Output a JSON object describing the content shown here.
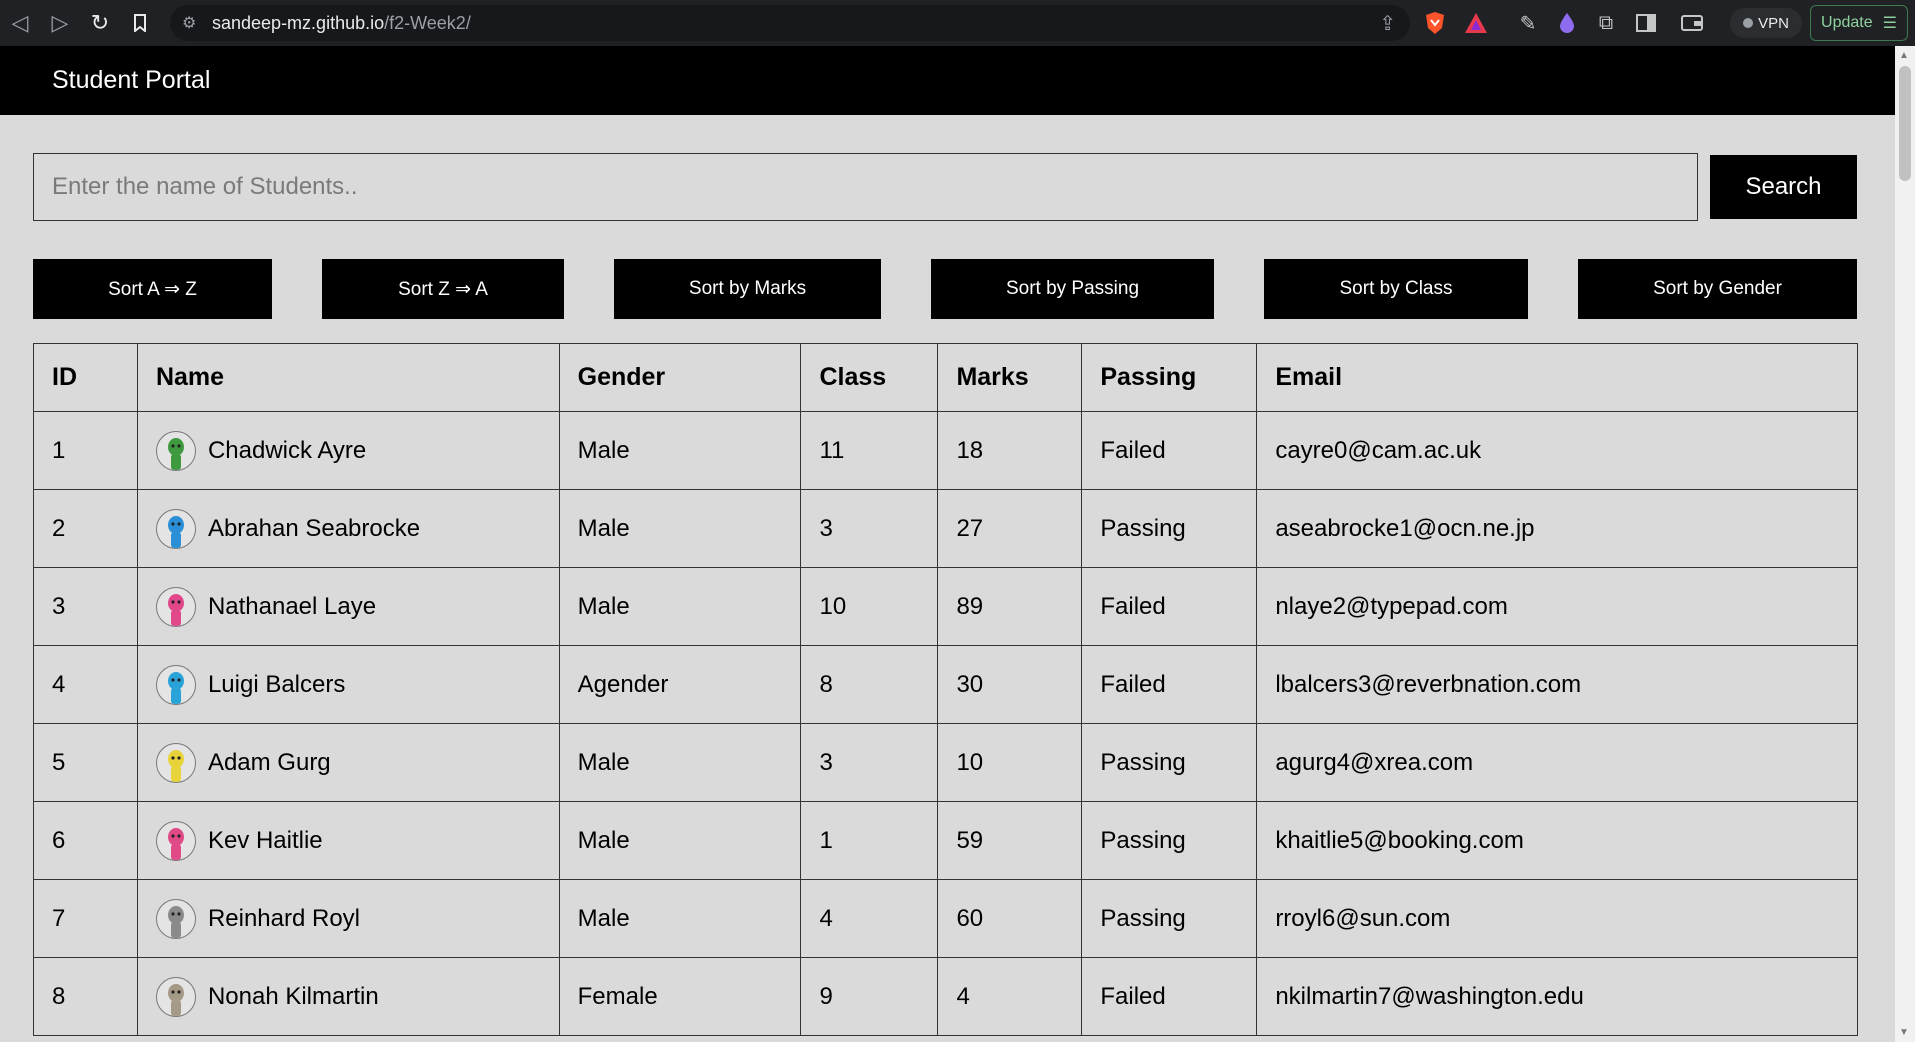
{
  "browser": {
    "url_host": "sandeep-mz.github.io",
    "url_path": "/f2-Week2/",
    "vpn_label": "VPN",
    "update_label": "Update"
  },
  "header": {
    "title": "Student Portal"
  },
  "search": {
    "placeholder": "Enter the name of Students..",
    "value": "",
    "button_label": "Search"
  },
  "sort_buttons": [
    {
      "label": "Sort A ⇒ Z"
    },
    {
      "label": "Sort Z ⇒ A"
    },
    {
      "label": "Sort by Marks"
    },
    {
      "label": "Sort by Passing"
    },
    {
      "label": "Sort by Class"
    },
    {
      "label": "Sort by Gender"
    }
  ],
  "table": {
    "columns": [
      "ID",
      "Name",
      "Gender",
      "Class",
      "Marks",
      "Passing",
      "Email"
    ],
    "rows": [
      {
        "id": "1",
        "name": "Chadwick Ayre",
        "gender": "Male",
        "class": "11",
        "marks": "18",
        "passing": "Failed",
        "email": "cayre0@cam.ac.uk",
        "avatar_color": "#3f9a3f"
      },
      {
        "id": "2",
        "name": "Abrahan Seabrocke",
        "gender": "Male",
        "class": "3",
        "marks": "27",
        "passing": "Passing",
        "email": "aseabrocke1@ocn.ne.jp",
        "avatar_color": "#2a8fd6"
      },
      {
        "id": "3",
        "name": "Nathanael Laye",
        "gender": "Male",
        "class": "10",
        "marks": "89",
        "passing": "Failed",
        "email": "nlaye2@typepad.com",
        "avatar_color": "#e0488a"
      },
      {
        "id": "4",
        "name": "Luigi Balcers",
        "gender": "Agender",
        "class": "8",
        "marks": "30",
        "passing": "Failed",
        "email": "lbalcers3@reverbnation.com",
        "avatar_color": "#2aa3d8"
      },
      {
        "id": "5",
        "name": "Adam Gurg",
        "gender": "Male",
        "class": "3",
        "marks": "10",
        "passing": "Passing",
        "email": "agurg4@xrea.com",
        "avatar_color": "#e8d43a"
      },
      {
        "id": "6",
        "name": "Kev Haitlie",
        "gender": "Male",
        "class": "1",
        "marks": "59",
        "passing": "Passing",
        "email": "khaitlie5@booking.com",
        "avatar_color": "#e04a86"
      },
      {
        "id": "7",
        "name": "Reinhard Royl",
        "gender": "Male",
        "class": "4",
        "marks": "60",
        "passing": "Passing",
        "email": "rroyl6@sun.com",
        "avatar_color": "#8a8a8a"
      },
      {
        "id": "8",
        "name": "Nonah Kilmartin",
        "gender": "Female",
        "class": "9",
        "marks": "4",
        "passing": "Failed",
        "email": "nkilmartin7@washington.edu",
        "avatar_color": "#a59a86"
      }
    ]
  }
}
